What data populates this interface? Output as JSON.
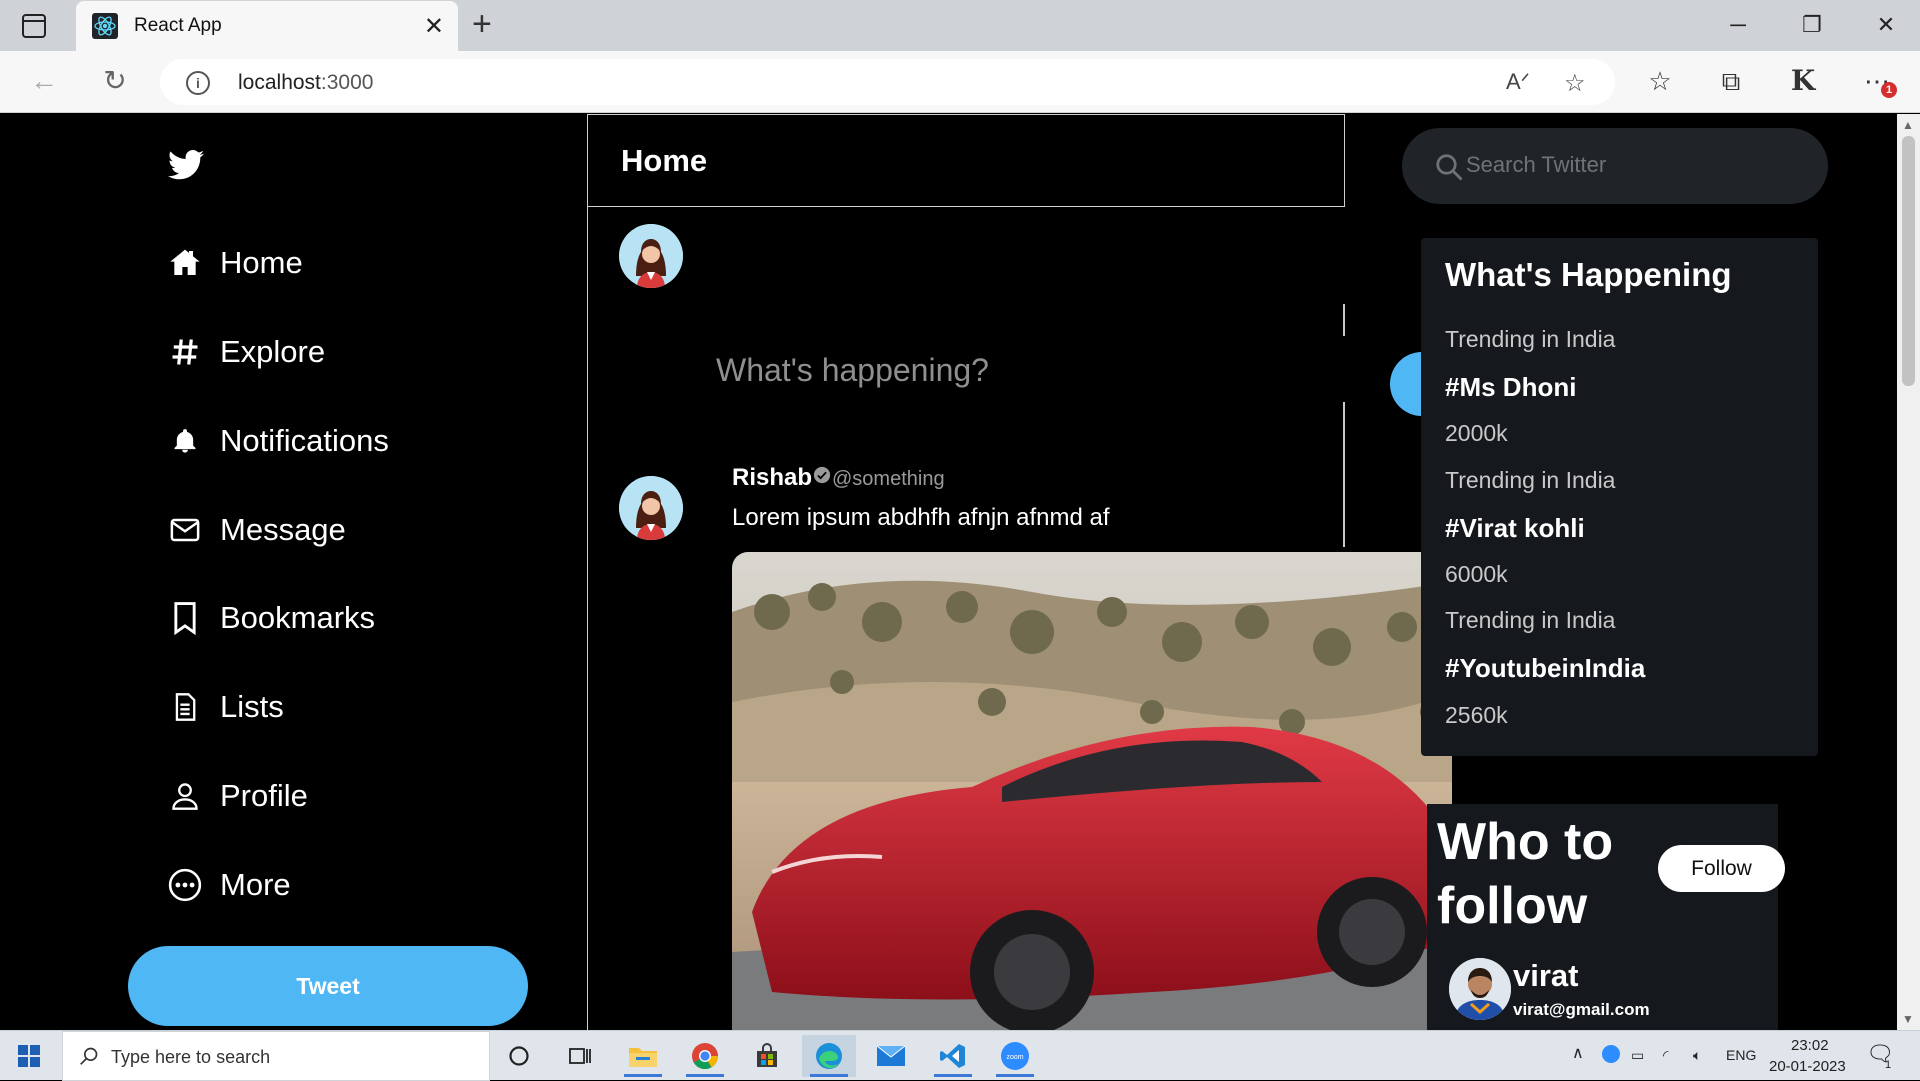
{
  "browser": {
    "tab_title": "React App",
    "url_host": "localhost",
    "url_port": ":3000",
    "notification_count": "1"
  },
  "sidebar": {
    "items": [
      {
        "label": "Home",
        "icon": "home-icon"
      },
      {
        "label": "Explore",
        "icon": "hashtag-icon"
      },
      {
        "label": "Notifications",
        "icon": "bell-icon"
      },
      {
        "label": "Message",
        "icon": "mail-icon"
      },
      {
        "label": "Bookmarks",
        "icon": "bookmark-icon"
      },
      {
        "label": "Lists",
        "icon": "list-icon"
      },
      {
        "label": "Profile",
        "icon": "user-icon"
      },
      {
        "label": "More",
        "icon": "more-icon"
      }
    ],
    "tweet_button": "Tweet"
  },
  "feed": {
    "title": "Home",
    "compose_placeholder": "What's happening?",
    "post": {
      "name": "Rishab",
      "handle": "@something",
      "text": "Lorem ipsum abdhfh afnjn afnmd af"
    }
  },
  "right": {
    "search_placeholder": "Search Twitter",
    "trends_title": "What's Happening",
    "trends": [
      {
        "category": "Trending in India",
        "tag": "#Ms Dhoni",
        "count": "2000k"
      },
      {
        "category": "Trending in India",
        "tag": "#Virat kohli",
        "count": "6000k"
      },
      {
        "category": "Trending in India",
        "tag": "#YoutubeinIndia",
        "count": "2560k"
      }
    ],
    "who_title": "Who to follow",
    "who": {
      "name": "virat",
      "email": "virat@gmail.com",
      "button": "Follow"
    }
  },
  "taskbar": {
    "search_text": "Type here to search",
    "language": "ENG",
    "time": "23:02",
    "date": "20-01-2023",
    "notification_count": "1"
  },
  "colors": {
    "accent": "#50b7f5",
    "background": "#000000",
    "card": "#15181c"
  }
}
